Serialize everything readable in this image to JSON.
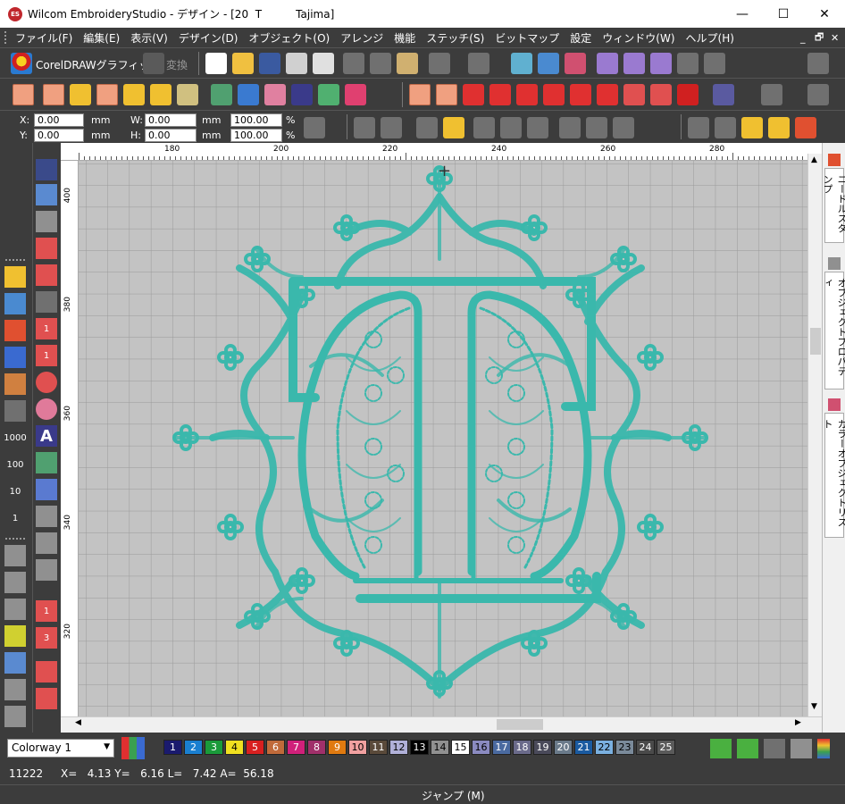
{
  "window": {
    "app_icon_text": "ES",
    "title": "Wilcom EmbroideryStudio - デザイン - [20  T          Tajima]",
    "minimize": "—",
    "maximize": "☐",
    "close": "✕"
  },
  "menu": {
    "items": [
      "ファイル(F)",
      "編集(E)",
      "表示(V)",
      "デザイン(D)",
      "オブジェクト(O)",
      "アレンジ",
      "機能",
      "ステッチ(S)",
      "ビットマップ",
      "設定",
      "ウィンドウ(W)",
      "ヘルプ(H)"
    ],
    "mdi_minimize": "_",
    "mdi_restore": "🗗",
    "mdi_close": "✕"
  },
  "toolbar1": {
    "coreldraw_label": "CorelDRAWグラフィック",
    "convert_label": "変換"
  },
  "fields": {
    "x_label": "X:",
    "x_value": "0.00",
    "y_label": "Y:",
    "y_value": "0.00",
    "w_label": "W:",
    "w_value": "0.00",
    "h_label": "H:",
    "h_value": "0.00",
    "unit_mm": "mm",
    "wpct_value": "100.00",
    "hpct_value": "100.00",
    "unit_pct": "%"
  },
  "ruler": {
    "top_ticks": [
      "180",
      "200",
      "220",
      "240",
      "260",
      "280"
    ],
    "left_ticks": [
      "400",
      "380",
      "360",
      "340",
      "320"
    ]
  },
  "left_toolbar": {
    "counters": [
      "1000",
      "100",
      "10",
      "1"
    ],
    "small_digits": [
      "1",
      "1",
      "1",
      "3"
    ]
  },
  "right_panel": {
    "tabs": [
      "ニードルスタンプ",
      "オブジェクトプロパティ",
      "カラーオブジェクトリスト"
    ]
  },
  "colorway": {
    "label": "Colorway 1",
    "swatches": [
      {
        "n": "1",
        "bg": "#1a1a6e",
        "fg": "#ffffff"
      },
      {
        "n": "2",
        "bg": "#1a7fd0",
        "fg": "#ffffff"
      },
      {
        "n": "3",
        "bg": "#1a9a3a",
        "fg": "#ffffff"
      },
      {
        "n": "4",
        "bg": "#f0e020",
        "fg": "#000000"
      },
      {
        "n": "5",
        "bg": "#d82020",
        "fg": "#ffffff"
      },
      {
        "n": "6",
        "bg": "#c06a3a",
        "fg": "#ffffff"
      },
      {
        "n": "7",
        "bg": "#d0207a",
        "fg": "#ffffff"
      },
      {
        "n": "8",
        "bg": "#a0306a",
        "fg": "#ffffff"
      },
      {
        "n": "9",
        "bg": "#e07a10",
        "fg": "#ffffff"
      },
      {
        "n": "10",
        "bg": "#f0a0a0",
        "fg": "#000000"
      },
      {
        "n": "11",
        "bg": "#5a4a3a",
        "fg": "#ffffff"
      },
      {
        "n": "12",
        "bg": "#b0b0d8",
        "fg": "#000000"
      },
      {
        "n": "13",
        "bg": "#000000",
        "fg": "#ffffff"
      },
      {
        "n": "14",
        "bg": "#909090",
        "fg": "#000000"
      },
      {
        "n": "15",
        "bg": "#ffffff",
        "fg": "#000000"
      },
      {
        "n": "16",
        "bg": "#8a8ac0",
        "fg": "#000000"
      },
      {
        "n": "17",
        "bg": "#4a6aa0",
        "fg": "#ffffff"
      },
      {
        "n": "18",
        "bg": "#6a6a8a",
        "fg": "#ffffff"
      },
      {
        "n": "19",
        "bg": "#4a4a5a",
        "fg": "#ffffff"
      },
      {
        "n": "20",
        "bg": "#6a7a8a",
        "fg": "#ffffff"
      },
      {
        "n": "21",
        "bg": "#1a5aa0",
        "fg": "#ffffff"
      },
      {
        "n": "22",
        "bg": "#7ab0e0",
        "fg": "#000000"
      },
      {
        "n": "23",
        "bg": "#7a8a9a",
        "fg": "#000000"
      },
      {
        "n": "24",
        "bg": "#4a4a4a",
        "fg": "#ffffff"
      },
      {
        "n": "25",
        "bg": "#5a5a5a",
        "fg": "#ffffff"
      }
    ]
  },
  "status": {
    "stitch_count": "11222",
    "coords": "X=   4.13 Y=   6.16 L=   7.42 A=  56.18",
    "mode": "ジャンプ (M)"
  },
  "design_color": "#3ab8ac"
}
